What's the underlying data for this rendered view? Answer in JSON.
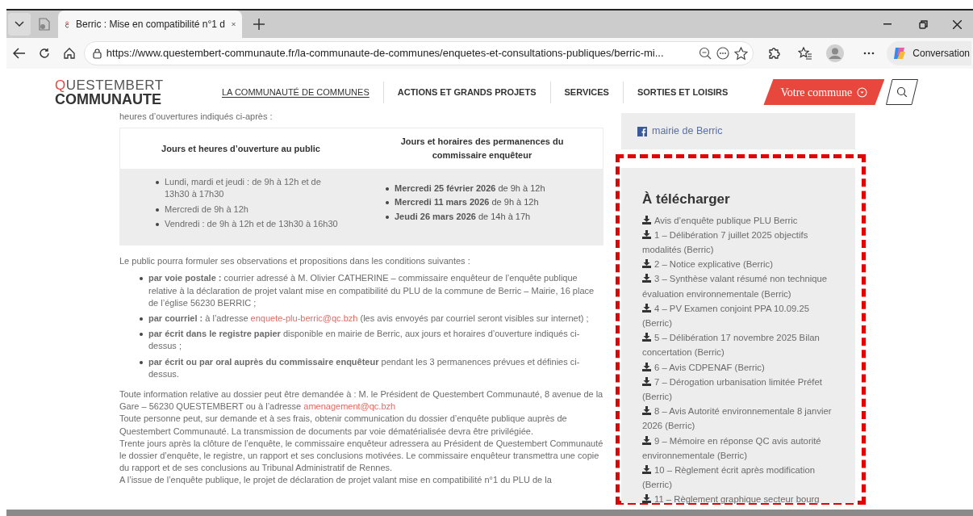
{
  "browser": {
    "tabs": [
      {
        "kind": "icon",
        "selected": false
      },
      {
        "kind": "page",
        "title": "Berric : Mise en compatibilité n°1 d",
        "selected": true
      }
    ],
    "url": "https://www.questembert-communaute.fr/la-communaute-de-communes/enquetes-et-consultations-publiques/berric-mi...",
    "copilot": "Conversation"
  },
  "site": {
    "logo": [
      "QUESTEMBERT",
      "COMMUNAUTE"
    ],
    "nav": [
      {
        "label": "LA COMMUNAUTÉ DE COMMUNES",
        "selected": true
      },
      {
        "label": "ACTIONS ET GRANDS PROJETS",
        "selected": false
      },
      {
        "label": "SERVICES",
        "selected": false
      },
      {
        "label": "SORTIES ET LOISIRS",
        "selected": false
      }
    ],
    "cta": "Votre commune"
  },
  "content": {
    "intro": "heures d’ouvertures indiqués ci-après :",
    "table": {
      "columns": [
        "Jours et heures d’ouverture au public",
        "Jours et horaires des permanences du commissaire enquêteur"
      ],
      "column_1": [
        "Lundi, mardi et jeudi : de 9h à 12h et de 13h30 à 17h30",
        "Mercredi de 9h à 12h",
        "Vendredi : de 9h à 12h et de 13h30 à 16h30"
      ],
      "column_2": [
        "**Mercredi 25 février 2026** de 9h à 12h",
        "**Mercredi 11 mars 2026** de 9h à 12h",
        "**Jeudi 26 mars 2026** de 14h à 17h"
      ]
    },
    "conditions_intro": "Le public pourra formuler ses observations et propositions dans les conditions suivantes :",
    "conditions": [
      [
        {
          "text": "**par voie postale :** courrier adressé à M. Olivier CATHERINE – commissaire enquêteur de l’enquête publique relative à la déclaration de projet valant mise en compatibilité du PLU de la commune de Berric – Mairie, 16 place de l’église 56230 BERRIC ;"
        }
      ],
      [
        {
          "text": "**par courriel :** à l’adresse "
        },
        {
          "link": "enquete-plu-berric@qc.bzh"
        },
        {
          "text": " (les avis envoyés par courriel seront visibles sur internet) ;"
        }
      ],
      [
        {
          "text": "**par écrit dans le registre papier** disponible en mairie de Berric, aux jours et horaires d’ouverture indiqués ci-dessus ;"
        }
      ],
      [
        {
          "text": "**par écrit ou par oral auprès du commissaire enquêteur** pendant les 3 permanences prévues et définies ci-dessus."
        }
      ]
    ],
    "paragraphs": [
      [
        {
          "text": "Toute information relative au dossier peut être demandée à : M. le Président de Questembert Communauté, 8 avenue de la Gare – 56230 QUESTEMBERT ou à l’adresse "
        },
        {
          "link": "amenagement@qc.bzh"
        }
      ],
      [
        {
          "text": "Toute personne peut, sur demande et à ses frais, obtenir communication du dossier d’enquête publique auprès de Questembert Communauté. La transmission de documents par voie dématérialisée devra être privilégiée."
        }
      ],
      [
        {
          "text": "Trente jours après la clôture de l’enquête, le commissaire enquêteur adressera au Président de Questembert Communauté le dossier d’enquête, le registre, un rapport et ses conclusions motivées. Le commissaire enquêteur transmettra une copie du rapport et de ses conclusions au Tribunal Administratif de Rennes."
        }
      ],
      [
        {
          "text": "A l’issue de l’enquête publique, le projet de déclaration de projet valant mise en compatibilité n°1 du PLU de la"
        }
      ]
    ]
  },
  "sidebar": {
    "facebook": "mairie de Berric",
    "downloads_title": "À télécharger",
    "downloads": [
      "Avis d’enquête publique PLU Berric",
      "1 – Délibération 7 juillet 2025 objectifs modalités (Berric)",
      "2 – Notice explicative (Berric)",
      "3 – Synthèse valant résumé non technique évaluation environnementale (Berric)",
      "4 – PV Examen conjoint PPA 10.09.25 (Berric)",
      "5 – Délibération 17 novembre 2025 Bilan concertation (Berric)",
      "6 – Avis CDPENAF (Berric)",
      "7 – Dérogation urbanisation limitée Préfet (Berric)",
      "8 – Avis Autorité environnementale 8 janvier 2026 (Berric)",
      "9 – Mémoire en réponse QC avis autorité environnementale (Berric)",
      "10 – Règlement écrit après modification (Berric)",
      "11 – Règlement graphique secteur bourg"
    ]
  }
}
